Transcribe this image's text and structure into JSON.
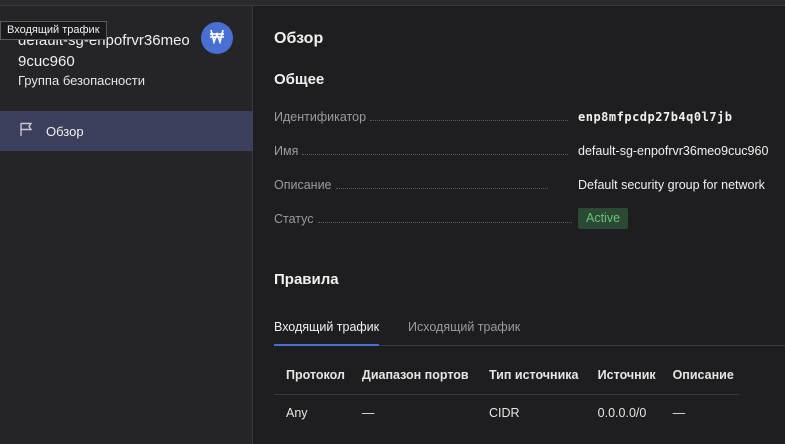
{
  "tooltip": {
    "text": "Входящий трафик"
  },
  "sidebar": {
    "resource_title": "default-sg-enpofrvr36meo9cuc960",
    "resource_subtitle": "Группа безопасности",
    "badge_icon": "network-icon",
    "items": [
      {
        "label": "Обзор",
        "icon": "flag-icon",
        "active": true
      }
    ]
  },
  "main": {
    "page_title": "Обзор",
    "general": {
      "title": "Общее",
      "rows": [
        {
          "key": "Идентификатор",
          "value": "enp8mfpcdp27b4q0l7jb"
        },
        {
          "key": "Имя",
          "value": "default-sg-enpofrvr36meo9cuc960"
        },
        {
          "key": "Описание",
          "value": "Default security group for network"
        },
        {
          "key": "Статус",
          "value": "Active"
        }
      ]
    },
    "rules": {
      "title": "Правила",
      "tabs": [
        {
          "label": "Входящий трафик",
          "active": true
        },
        {
          "label": "Исходящий трафик",
          "active": false
        }
      ],
      "columns": [
        "Протокол",
        "Диапазон портов",
        "Тип источника",
        "Источник",
        "Описание"
      ],
      "rows": [
        [
          "Any",
          "—",
          "CIDR",
          "0.0.0.0/0",
          "—"
        ]
      ]
    }
  },
  "colors": {
    "accent": "#4a6fd3",
    "status_green": "#63c27a",
    "active_nav": "#3b3f5c"
  }
}
